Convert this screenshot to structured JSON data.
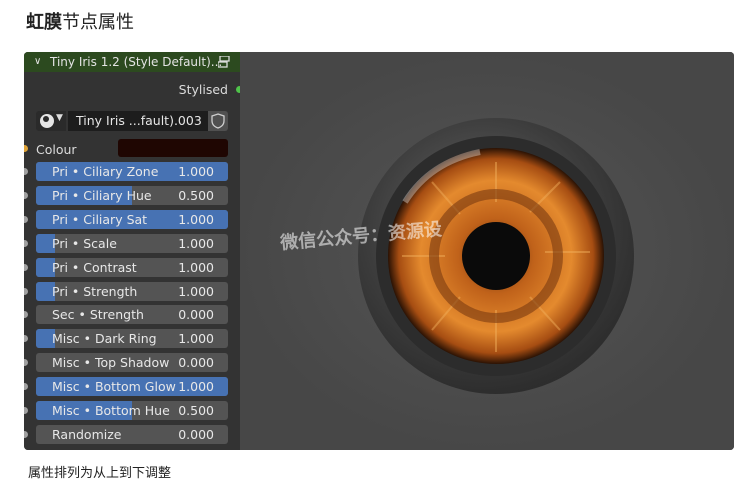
{
  "page_title": {
    "bold": "虹膜",
    "rest": "节点属性"
  },
  "node": {
    "title": "Tiny Iris 1.2 (Style Default)...",
    "output_label": "Stylised",
    "group_name": "Tiny Iris ...fault).003",
    "colour_label": "Colour",
    "colour_value": "#1f0602",
    "sliders": [
      {
        "label": "Pri • Ciliary Zone",
        "value": "1.000",
        "fill": 1.0
      },
      {
        "label": "Pri • Ciliary Hue",
        "value": "0.500",
        "fill": 0.5
      },
      {
        "label": "Pri • Ciliary Sat",
        "value": "1.000",
        "fill": 1.0
      },
      {
        "label": "Pri • Scale",
        "value": "1.000",
        "fill": 0.1
      },
      {
        "label": "Pri • Contrast",
        "value": "1.000",
        "fill": 0.1
      },
      {
        "label": "Pri • Strength",
        "value": "1.000",
        "fill": 0.1
      },
      {
        "label": "Sec • Strength",
        "value": "0.000",
        "fill": 0.0
      },
      {
        "label": "Misc • Dark Ring",
        "value": "1.000",
        "fill": 0.1
      },
      {
        "label": "Misc • Top Shadow",
        "value": "0.000",
        "fill": 0.0
      },
      {
        "label": "Misc • Bottom Glow",
        "value": "1.000",
        "fill": 1.0
      },
      {
        "label": "Misc • Bottom Hue",
        "value": "0.500",
        "fill": 0.5
      },
      {
        "label": "Randomize",
        "value": "0.000",
        "fill": 0.0
      }
    ]
  },
  "viewport": {
    "watermark": "微信公众号：资源设"
  },
  "caption": "属性排列为从上到下调整",
  "colors": {
    "accent": "#4772b3",
    "header": "#2c4a1f",
    "socket_output": "#4fc34a",
    "socket_colour": "#e0a437"
  }
}
